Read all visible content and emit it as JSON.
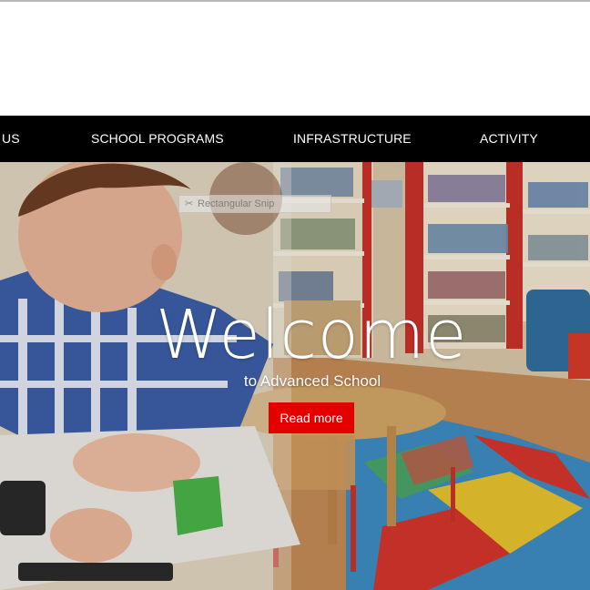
{
  "nav": {
    "items": [
      {
        "label": "US"
      },
      {
        "label": "SCHOOL PROGRAMS"
      },
      {
        "label": "INFRASTRUCTURE"
      },
      {
        "label": "ACTIVITY"
      }
    ]
  },
  "hero": {
    "title": "Welcome",
    "subtitle": "to Advanced School",
    "button_label": "Read more",
    "tooltip_text": "Rectangular Snip",
    "tooltip_icon": "scissors-icon"
  },
  "colors": {
    "navbar_bg": "#000000",
    "nav_text": "#ffffff",
    "button_bg": "#e50000",
    "shelf_red": "#c8322a"
  }
}
